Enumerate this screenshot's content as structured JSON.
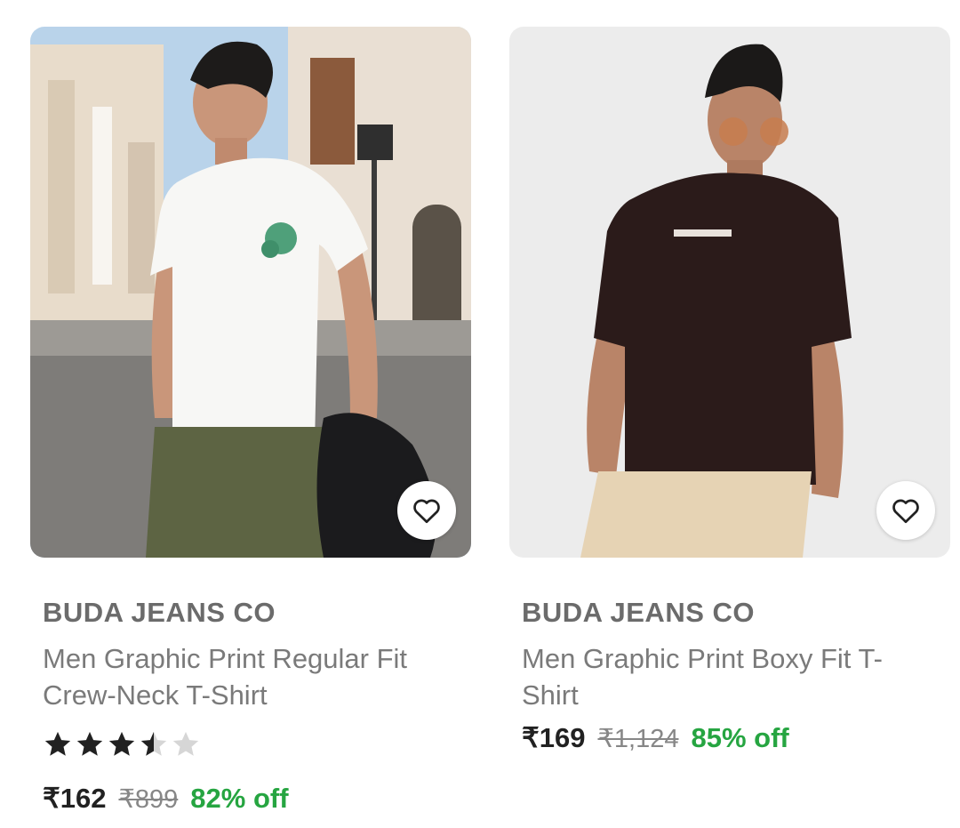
{
  "products": [
    {
      "brand": "BUDA JEANS CO",
      "title": "Men Graphic Print Regular Fit Crew-Neck T-Shirt",
      "rating_stars": 3.5,
      "rating_max": 5,
      "price": "₹162",
      "mrp": "₹899",
      "discount": "82% off",
      "image_desc": "man-white-tshirt-street"
    },
    {
      "brand": "BUDA JEANS CO",
      "title": "Men Graphic Print Boxy Fit T-Shirt",
      "price": "₹169",
      "mrp": "₹1,124",
      "discount": "85% off",
      "image_desc": "man-brown-tshirt-studio"
    }
  ],
  "icons": {
    "wishlist": "heart-outline-icon",
    "rating": "star-icon"
  },
  "colors": {
    "discount": "#26a541",
    "star_filled": "#212121",
    "star_empty": "#d6d6d6",
    "brand": "#6b6b6b"
  }
}
